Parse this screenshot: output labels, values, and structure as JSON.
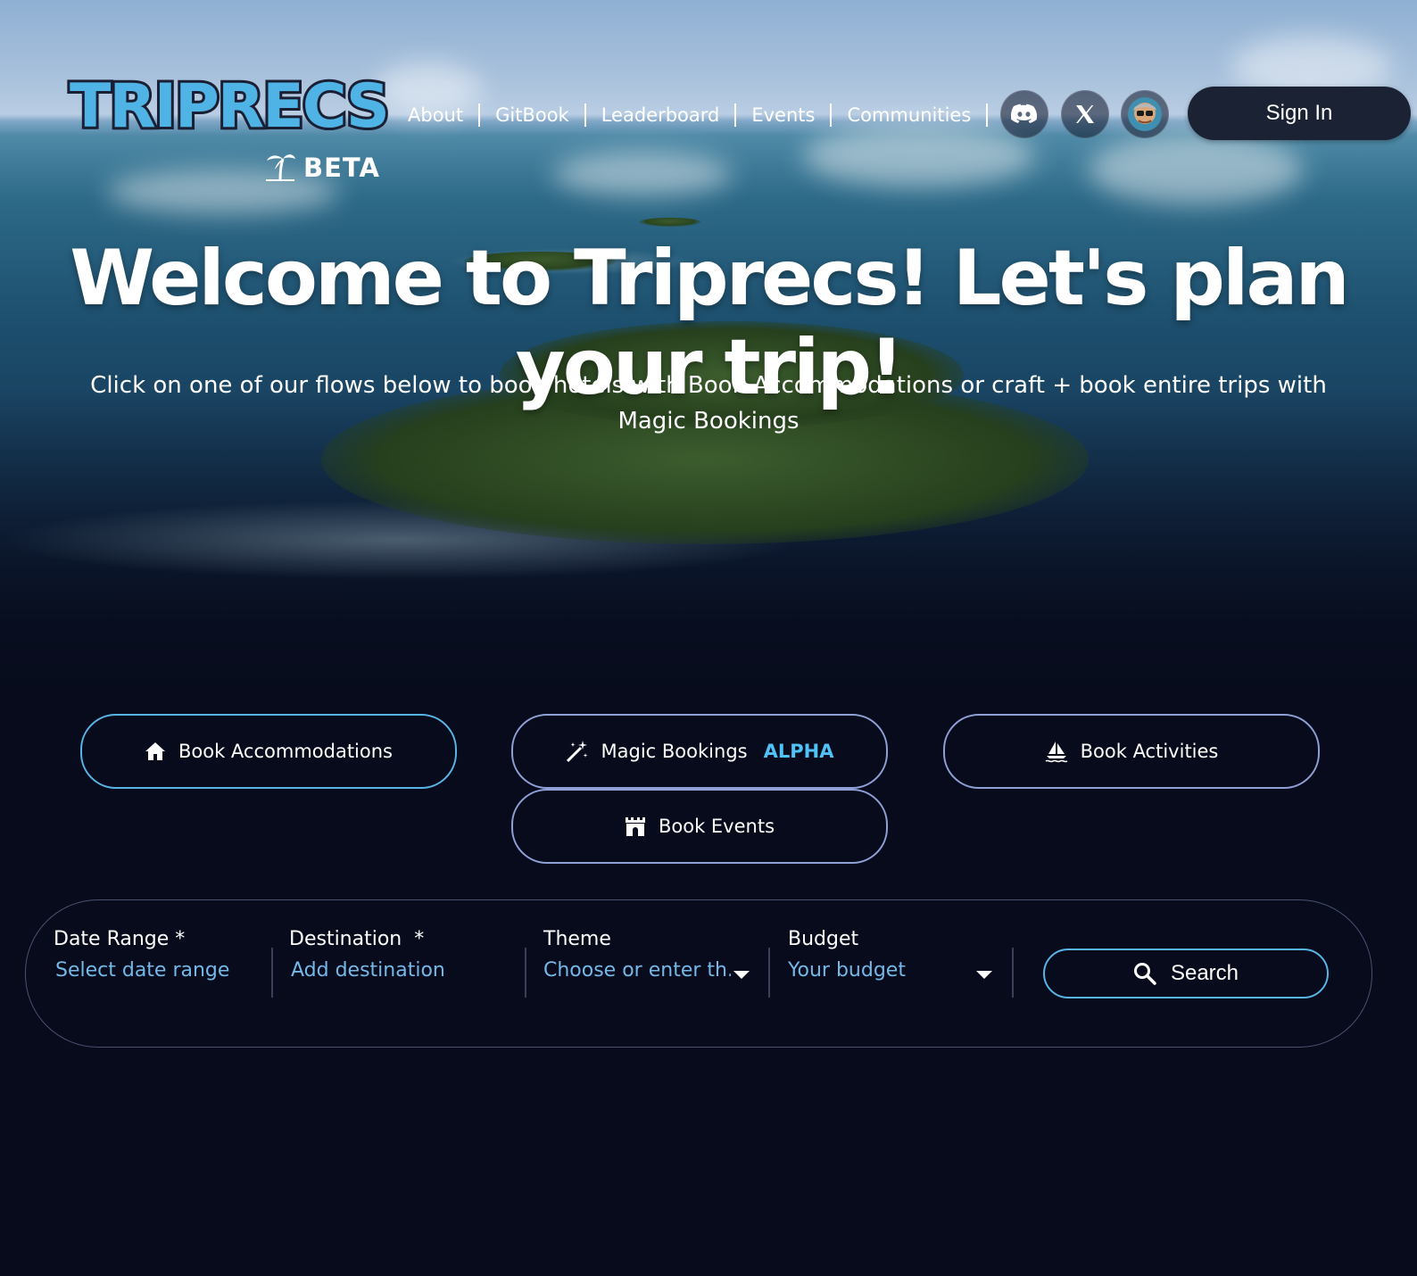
{
  "header": {
    "logo_text": "TRIPRECS",
    "beta_label": "BETA",
    "nav": [
      "About",
      "GitBook",
      "Leaderboard",
      "Events",
      "Communities"
    ],
    "social_icons": [
      "discord-icon",
      "x-icon",
      "avatar"
    ],
    "sign_in_label": "Sign In"
  },
  "hero": {
    "title": "Welcome to Triprecs! Let's plan your trip!",
    "subtitle": "Click on one of our flows below to book hotels with Book Accommodations or craft + book entire trips with Magic Bookings"
  },
  "flows": {
    "accommodations": {
      "label": "Book Accommodations",
      "icon": "home-icon"
    },
    "magic": {
      "label": "Magic Bookings",
      "badge": "ALPHA",
      "icon": "magic-wand-icon"
    },
    "activities": {
      "label": "Book Activities",
      "icon": "sailboat-icon"
    },
    "events": {
      "label": "Book Events",
      "icon": "castle-icon"
    }
  },
  "search": {
    "date_range": {
      "label": "Date Range *",
      "placeholder": "Select date range"
    },
    "destination": {
      "label": "Destination  *",
      "placeholder": "Add destination"
    },
    "theme": {
      "label": "Theme",
      "placeholder": "Choose or enter th..."
    },
    "budget": {
      "label": "Budget",
      "placeholder": "Your budget"
    },
    "button_label": "Search"
  },
  "colors": {
    "background": "#070b1c",
    "accent": "#59b4e6",
    "placeholder": "#74b8e8",
    "alpha_badge": "#4fc3f7",
    "sign_in_bg": "#1b2233"
  }
}
